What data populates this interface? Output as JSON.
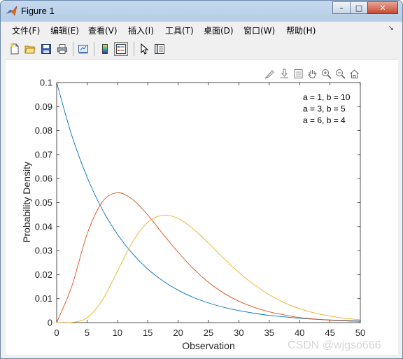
{
  "window": {
    "title": "Figure 1",
    "buttons": {
      "minimize": "–",
      "maximize": "□",
      "close": "✕"
    }
  },
  "menu": {
    "items": [
      "文件(F)",
      "编辑(E)",
      "查看(V)",
      "插入(I)",
      "工具(T)",
      "桌面(D)",
      "窗口(W)",
      "帮助(H)"
    ],
    "overflow": "↘"
  },
  "toolbar": {
    "icons": [
      "new-figure-icon",
      "open-file-icon",
      "save-icon",
      "print-icon",
      "link-plot-icon",
      "colorbar-icon",
      "legend-icon",
      "pointer-icon",
      "property-inspector-icon"
    ]
  },
  "axes_toolbar": {
    "icons": [
      "brush-icon",
      "data-tips-icon",
      "pan-icon",
      "zoom-in-icon",
      "zoom-out-icon",
      "home-icon"
    ]
  },
  "watermark": "CSDN @wjgso666",
  "colors": {
    "series1": "#0072bd",
    "series2": "#d95319",
    "series3": "#edb120"
  },
  "chart_data": {
    "type": "line",
    "xlabel": "Observation",
    "ylabel": "Probability Density",
    "xlim": [
      0,
      50
    ],
    "ylim": [
      0,
      0.1
    ],
    "xticks": [
      "0",
      "5",
      "10",
      "15",
      "20",
      "25",
      "30",
      "35",
      "40",
      "45",
      "50"
    ],
    "yticks": [
      "0",
      "0.01",
      "0.02",
      "0.03",
      "0.04",
      "0.05",
      "0.06",
      "0.07",
      "0.08",
      "0.09",
      "0.1"
    ],
    "legend_position": "top-right",
    "grid": false,
    "series": [
      {
        "name": "a = 1, b = 10",
        "color": "#0072bd",
        "x": [
          0,
          2.5,
          5,
          7.5,
          10,
          12.5,
          15,
          17.5,
          20,
          22.5,
          25,
          27.5,
          30,
          32.5,
          35,
          37.5,
          40,
          42.5,
          45,
          47.5,
          50
        ],
        "y": [
          0.1,
          0.0779,
          0.0607,
          0.0472,
          0.0368,
          0.0287,
          0.0223,
          0.0174,
          0.0135,
          0.0105,
          0.0082,
          0.0064,
          0.005,
          0.0039,
          0.003,
          0.0024,
          0.0018,
          0.0014,
          0.0011,
          0.0009,
          0.0007
        ]
      },
      {
        "name": "a = 3, b = 5",
        "color": "#d95319",
        "x": [
          0,
          2.5,
          5,
          7.5,
          10,
          12.5,
          15,
          17.5,
          20,
          22.5,
          25,
          27.5,
          30,
          32.5,
          35,
          37.5,
          40,
          42.5,
          45,
          47.5,
          50
        ],
        "y": [
          0,
          0.0152,
          0.0368,
          0.0502,
          0.0541,
          0.0513,
          0.0448,
          0.0369,
          0.0293,
          0.0225,
          0.0168,
          0.0123,
          0.0089,
          0.0064,
          0.0045,
          0.0032,
          0.0021,
          0.0015,
          0.001,
          0.0007,
          0.0005
        ]
      },
      {
        "name": "a = 6, b = 4",
        "color": "#edb120",
        "x": [
          0,
          2.5,
          5,
          7.5,
          10,
          12.5,
          15,
          17.5,
          20,
          22.5,
          25,
          27.5,
          30,
          32.5,
          35,
          37.5,
          40,
          42.5,
          45,
          47.5,
          50
        ],
        "y": [
          0,
          0.0001,
          0.002,
          0.0093,
          0.0214,
          0.0336,
          0.0418,
          0.0447,
          0.0434,
          0.039,
          0.0331,
          0.0268,
          0.0209,
          0.0158,
          0.0116,
          0.0083,
          0.0058,
          0.004,
          0.0027,
          0.0018,
          0.0012
        ]
      }
    ]
  }
}
